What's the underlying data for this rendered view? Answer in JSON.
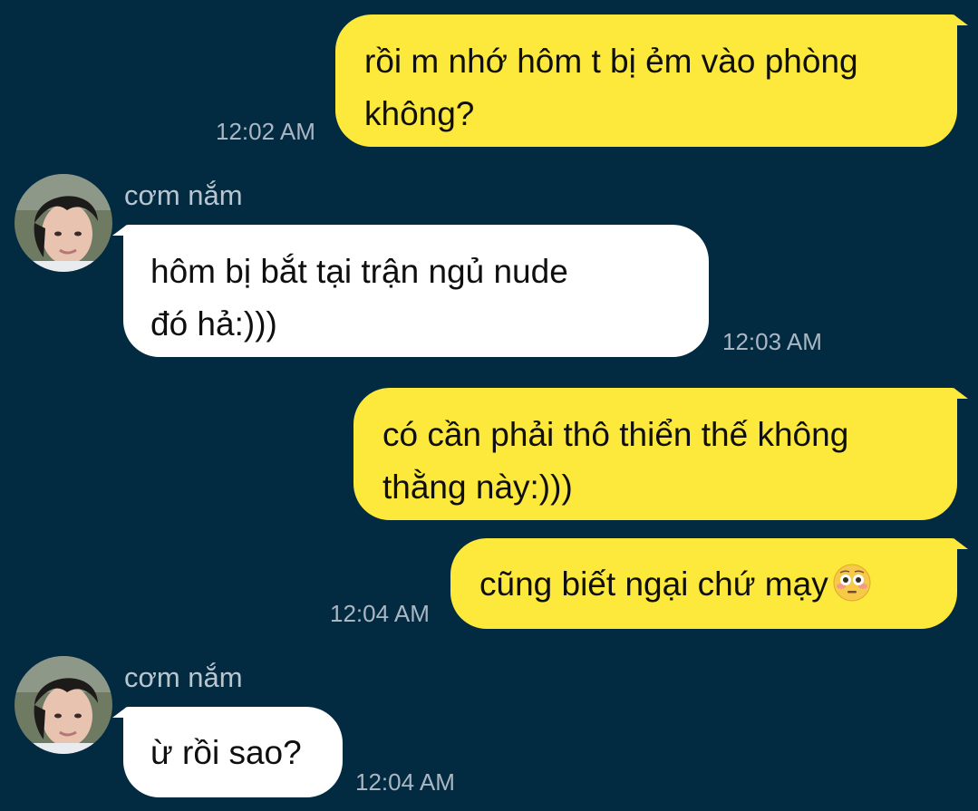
{
  "conversation": {
    "contact_name": "cơm nắm",
    "messages": [
      {
        "direction": "outgoing",
        "lines": [
          "rồi m nhớ hôm t bị ẻm vào phòng",
          "không?"
        ],
        "time": "12:02 AM"
      },
      {
        "direction": "incoming",
        "sender": "cơm nắm",
        "lines": [
          "hôm bị bắt tại trận ngủ nude",
          "đó hả:)))"
        ],
        "time": "12:03 AM"
      },
      {
        "direction": "outgoing",
        "lines": [
          "có cần phải thô thiển thế không",
          "thằng này:)))"
        ],
        "time": ""
      },
      {
        "direction": "outgoing",
        "lines": [
          "cũng biết ngại chứ mạy"
        ],
        "emoji": "flushed-face-emoji",
        "time": "12:04 AM"
      },
      {
        "direction": "incoming",
        "sender": "cơm nắm",
        "lines": [
          "ừ rồi sao?"
        ],
        "time": "12:04 AM"
      }
    ]
  },
  "colors": {
    "background": "#022a41",
    "outgoing_bubble": "#fde93b",
    "incoming_bubble": "#ffffff",
    "message_text": "#0f0f0f",
    "timestamp_text": "#aab7c2",
    "sender_text": "#b9c5cf"
  }
}
